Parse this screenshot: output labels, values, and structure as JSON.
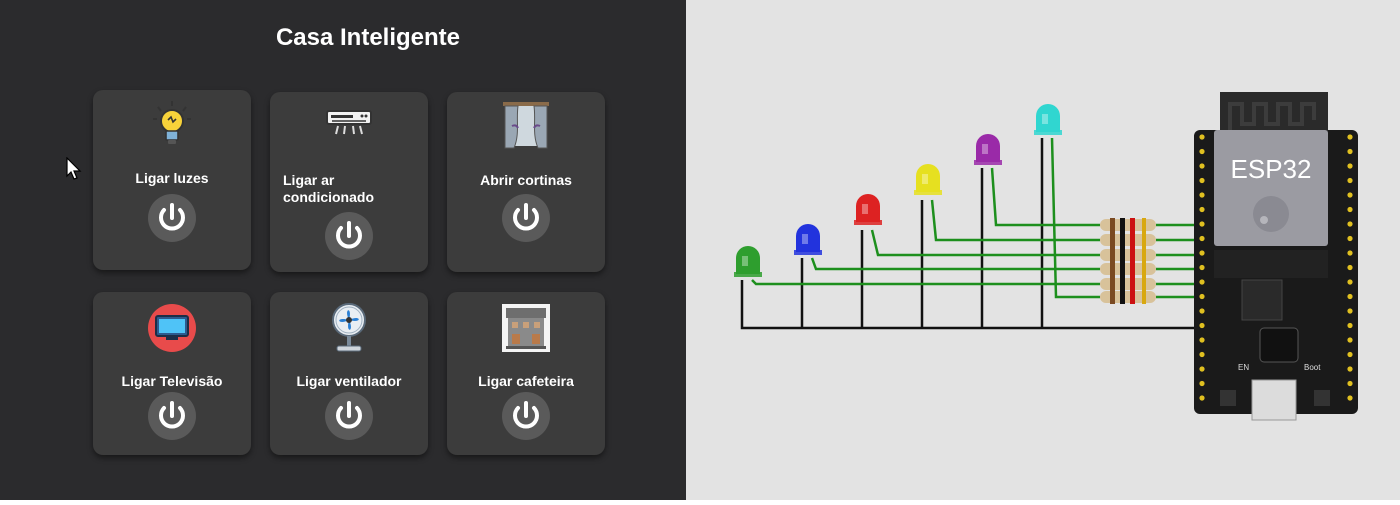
{
  "app": {
    "title": "Casa Inteligente"
  },
  "devices": [
    {
      "label": "Ligar luzes",
      "icon": "lightbulb-icon"
    },
    {
      "label": "Ligar ar condicionado",
      "icon": "air-conditioner-icon"
    },
    {
      "label": "Abrir cortinas",
      "icon": "curtains-icon"
    },
    {
      "label": "Ligar Televisão",
      "icon": "television-icon"
    },
    {
      "label": "Ligar ventilador",
      "icon": "fan-icon"
    },
    {
      "label": "Ligar cafeteira",
      "icon": "coffee-machine-icon"
    }
  ],
  "power_icon": "power-icon",
  "simulator": {
    "board_label": "ESP32",
    "en_label": "EN",
    "boot_label": "Boot",
    "led_colors": [
      "#2e9e2e",
      "#2233dd",
      "#dd2222",
      "#e6e020",
      "#9a2aa8",
      "#30d6d0"
    ]
  }
}
